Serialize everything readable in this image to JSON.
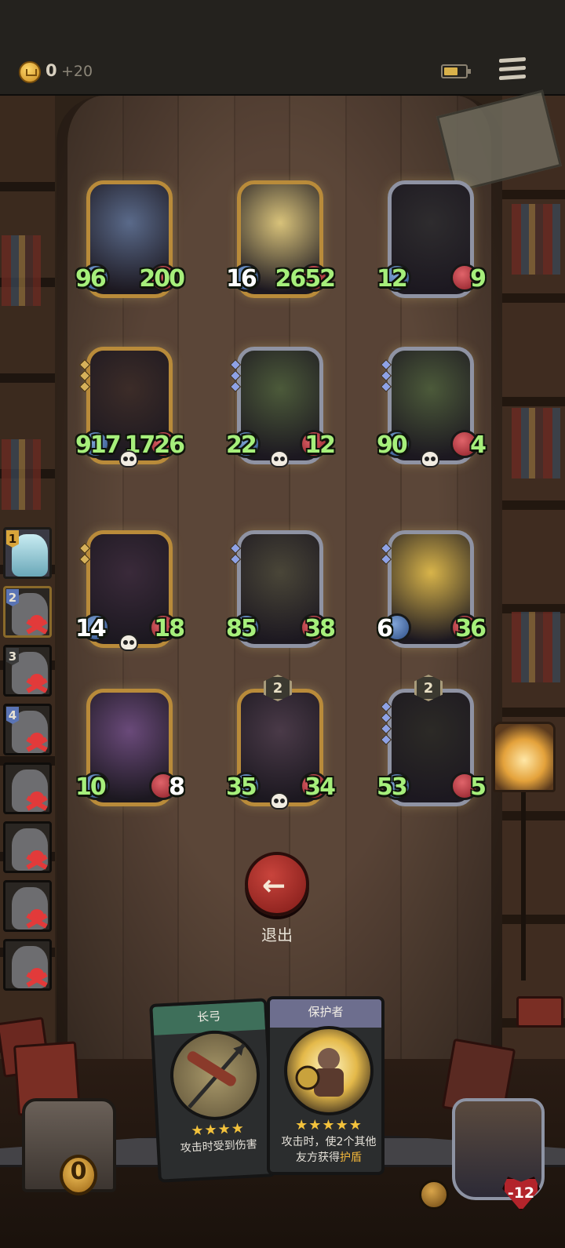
{
  "header": {
    "coins": "0",
    "coin_bonus": "+20",
    "battery_icon": "battery-icon",
    "menu_icon": "menu-icon"
  },
  "heroes": [
    {
      "atk": "96",
      "hp": "200",
      "frame": "gold",
      "skin": "#5a6a8a",
      "skull": false
    },
    {
      "atk": "16",
      "hp": "2652",
      "frame": "gold",
      "skin": "#d8c27a",
      "skull": false,
      "atk_white": true
    },
    {
      "atk": "12",
      "hp": "9",
      "frame": "silver",
      "skin": "#2e2c2e",
      "skull": false
    },
    {
      "atk": "917",
      "hp": "1726",
      "frame": "gold",
      "skin": "#3c2c28",
      "skull": true,
      "pips": 3
    },
    {
      "atk": "22",
      "hp": "12",
      "frame": "silver",
      "skin": "#4c5a3a",
      "skull": true,
      "pips": 3
    },
    {
      "atk": "90",
      "hp": "4",
      "frame": "silver",
      "skin": "#4c5a3a",
      "skull": true,
      "pips": 3
    },
    {
      "atk": "14",
      "hp": "18",
      "frame": "gold",
      "skin": "#3a2a3a",
      "skull": true,
      "pips": 2,
      "atk_white": true
    },
    {
      "atk": "85",
      "hp": "38",
      "frame": "silver",
      "skin": "#4a4638",
      "skull": false,
      "pips": 2
    },
    {
      "atk": "6",
      "hp": "36",
      "frame": "silver",
      "skin": "#d8b44a",
      "skull": false,
      "pips": 2,
      "atk_white": true
    },
    {
      "atk": "10",
      "hp": "8",
      "frame": "gold",
      "skin": "#6a4a7a",
      "skull": false,
      "hp_white": true
    },
    {
      "atk": "35",
      "hp": "34",
      "frame": "gold",
      "skin": "#4a3a48",
      "skull": true,
      "level": "2"
    },
    {
      "atk": "53",
      "hp": "5",
      "frame": "silver",
      "skin": "#2c2a26",
      "skull": false,
      "level": "2",
      "pips": 4
    }
  ],
  "team": [
    {
      "num": "1",
      "style": "gold",
      "dead": false
    },
    {
      "num": "2",
      "style": "blue",
      "dead": true
    },
    {
      "num": "3",
      "style": "plain",
      "dead": true
    },
    {
      "num": "4",
      "style": "blue",
      "dead": true
    },
    {
      "num": "",
      "style": "none",
      "dead": true
    },
    {
      "num": "",
      "style": "none",
      "dead": true
    },
    {
      "num": "",
      "style": "none",
      "dead": true
    },
    {
      "num": "",
      "style": "none",
      "dead": true
    }
  ],
  "exit": {
    "label": "退出",
    "icon": "arrow-left-icon"
  },
  "chest": {
    "count": "0"
  },
  "skill_cards": [
    {
      "title": "长弓",
      "stars": "★★★★",
      "desc": "攻击时受到伤害"
    },
    {
      "title": "保护者",
      "stars": "★★★★★",
      "desc_a": "攻击时，使2个其他",
      "desc_b": "友方获得",
      "desc_highlight": "护盾"
    }
  ],
  "boss": {
    "hp": "-12"
  }
}
